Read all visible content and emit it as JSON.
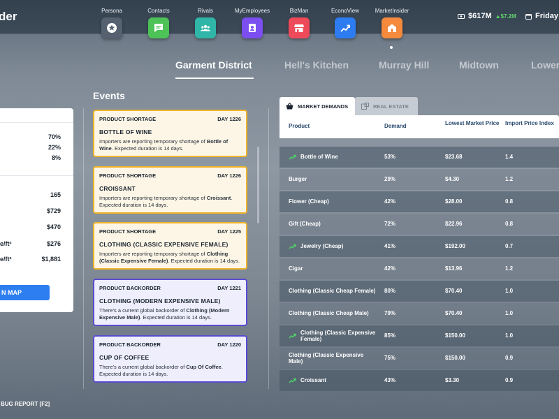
{
  "app": {
    "title_partial": "der"
  },
  "nav": [
    {
      "label": "Persona",
      "icon": "star-icon",
      "color": "#55616e"
    },
    {
      "label": "Contacts",
      "icon": "chat-icon",
      "color": "#4cc257"
    },
    {
      "label": "Rivals",
      "icon": "group-icon",
      "color": "#2fb6a8"
    },
    {
      "label": "MyEmployees",
      "icon": "badge-icon",
      "color": "#7b4ef2"
    },
    {
      "label": "BizMan",
      "icon": "store-icon",
      "color": "#ef4a5a"
    },
    {
      "label": "EconoView",
      "icon": "trend-icon",
      "color": "#2e7cf2"
    },
    {
      "label": "MarketInsider",
      "icon": "building-icon",
      "color": "#f58a3c"
    }
  ],
  "status": {
    "money": "$617M",
    "money_delta": "▲$7.2M",
    "date": "Friday"
  },
  "districts": [
    "Garment District",
    "Hell's Kitchen",
    "Murray Hill",
    "Midtown",
    "Lower"
  ],
  "left_panel": {
    "percents": [
      "70%",
      "22%",
      "8%"
    ],
    "values": [
      "165",
      "$729",
      "$470",
      "$276",
      "$1,881"
    ],
    "labels": [
      "e/ft²",
      "e/ft²"
    ],
    "map_button": "N MAP"
  },
  "events": {
    "title": "Events",
    "items": [
      {
        "type": "PRODUCT SHORTAGE",
        "day": "DAY 1226",
        "name": "BOTTLE OF WINE",
        "pre": "Importers are reporting temporary shortage of ",
        "item": "Bottle of Wine",
        "post": ". Expected duration is 14 days."
      },
      {
        "type": "PRODUCT SHORTAGE",
        "day": "DAY 1226",
        "name": "CROISSANT",
        "pre": "Importers are reporting temporary shortage of ",
        "item": "Croissant",
        "post": ". Expected duration is 14 days."
      },
      {
        "type": "PRODUCT SHORTAGE",
        "day": "DAY 1225",
        "name": "CLOTHING (CLASSIC EXPENSIVE FEMALE)",
        "pre": "Importers are reporting temporary shortage of ",
        "item": "Clothing (Classic Expensive Female)",
        "post": ". Expected duration is 14 days."
      },
      {
        "type": "PRODUCT BACKORDER",
        "day": "DAY 1221",
        "name": "CLOTHING (MODERN EXPENSIVE MALE)",
        "pre": "There's a current global backorder of ",
        "item": "Clothing (Modern Expensive Male)",
        "post": ". Expected duration is 14 days."
      },
      {
        "type": "PRODUCT BACKORDER",
        "day": "DAY 1220",
        "name": "CUP OF COFFEE",
        "pre": "There's a current global backorder of ",
        "item": "Cup Of Coffee",
        "post": ". Expected duration is 14 days."
      }
    ]
  },
  "market": {
    "tabs": [
      "MARKET DEMANDS",
      "REAL ESTATE"
    ],
    "headers": [
      "Product",
      "Demand",
      "Lowest Market Price",
      "Import Price Index"
    ],
    "rows": [
      {
        "product": "Bottle of Wine",
        "demand": "53%",
        "price": "$23.68",
        "index": "1.4",
        "trend": true
      },
      {
        "product": "Burger",
        "demand": "29%",
        "price": "$4.30",
        "index": "1.2",
        "trend": false
      },
      {
        "product": "Flower (Cheap)",
        "demand": "42%",
        "price": "$28.00",
        "index": "0.8",
        "trend": false
      },
      {
        "product": "Gift (Cheap)",
        "demand": "72%",
        "price": "$22.96",
        "index": "0.8",
        "trend": false
      },
      {
        "product": "Jewelry (Cheap)",
        "demand": "41%",
        "price": "$192.00",
        "index": "0.7",
        "trend": true
      },
      {
        "product": "Cigar",
        "demand": "42%",
        "price": "$13.96",
        "index": "1.2",
        "trend": false
      },
      {
        "product": "Clothing (Classic Cheap Female)",
        "demand": "80%",
        "price": "$70.40",
        "index": "1.0",
        "trend": false
      },
      {
        "product": "Clothing (Classic Cheap Male)",
        "demand": "79%",
        "price": "$70.40",
        "index": "1.0",
        "trend": false
      },
      {
        "product": "Clothing (Classic Expensive Female)",
        "demand": "85%",
        "price": "$150.00",
        "index": "1.0",
        "trend": true
      },
      {
        "product": "Clothing (Classic Expensive Male)",
        "demand": "75%",
        "price": "$150.00",
        "index": "0.9",
        "trend": false
      },
      {
        "product": "Croissant",
        "demand": "43%",
        "price": "$3.30",
        "index": "0.9",
        "trend": true
      }
    ]
  },
  "footer": {
    "bug_report": "BUG REPORT [F2]"
  }
}
